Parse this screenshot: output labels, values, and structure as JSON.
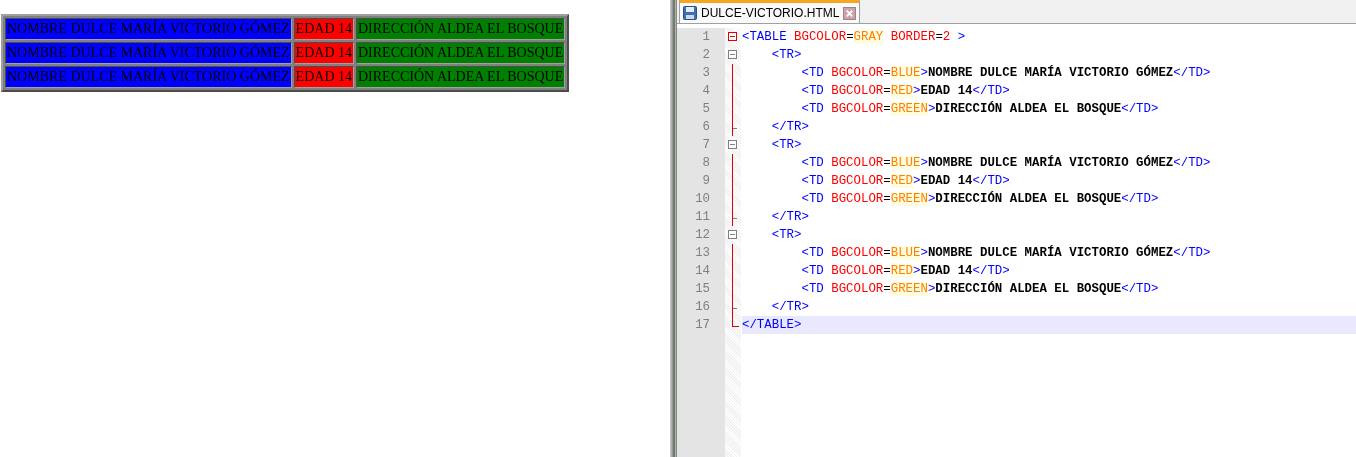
{
  "preview": {
    "table": {
      "rows": [
        {
          "cells": [
            {
              "text": "NOMBRE DULCE MARÍA VICTORIO GÓMEZ",
              "color": "#0000ff"
            },
            {
              "text": "EDAD 14",
              "color": "#ff0000"
            },
            {
              "text": "DIRECCIÓN ALDEA EL BOSQUE",
              "color": "#008000"
            }
          ]
        },
        {
          "cells": [
            {
              "text": "NOMBRE DULCE MARÍA VICTORIO GÓMEZ",
              "color": "#0000ff"
            },
            {
              "text": "EDAD 14",
              "color": "#ff0000"
            },
            {
              "text": "DIRECCIÓN ALDEA EL BOSQUE",
              "color": "#008000"
            }
          ]
        },
        {
          "cells": [
            {
              "text": "NOMBRE DULCE MARÍA VICTORIO GÓMEZ",
              "color": "#0000ff"
            },
            {
              "text": "EDAD 14",
              "color": "#ff0000"
            },
            {
              "text": "DIRECCIÓN ALDEA EL BOSQUE",
              "color": "#008000"
            }
          ]
        }
      ]
    }
  },
  "editor": {
    "tabs": [
      {
        "label": "DULCE-VICTORIO.HTML",
        "selected": true
      }
    ],
    "lines": [
      {
        "number": "1",
        "kind": "outer-start",
        "current": false,
        "tokens": [
          {
            "kind": "tag",
            "text": "<TABLE"
          },
          {
            "kind": "attr",
            "text": " BGCOLOR"
          },
          {
            "kind": "eq",
            "text": "="
          },
          {
            "kind": "value",
            "text": "GRAY"
          },
          {
            "kind": "attr",
            "text": " BORDER"
          },
          {
            "kind": "eq",
            "text": "="
          },
          {
            "kind": "number",
            "text": "2"
          },
          {
            "kind": "tag",
            "text": " >"
          }
        ]
      },
      {
        "number": "2",
        "kind": "inner-start",
        "current": false,
        "tokens": [
          {
            "kind": "tag",
            "text": "    <TR>"
          }
        ]
      },
      {
        "number": "3",
        "kind": "body",
        "current": false,
        "tokens": [
          {
            "kind": "tag",
            "text": "        <TD"
          },
          {
            "kind": "attr",
            "text": " BGCOLOR"
          },
          {
            "kind": "eq",
            "text": "="
          },
          {
            "kind": "value",
            "text": "BLUE"
          },
          {
            "kind": "tag",
            "text": ">"
          },
          {
            "kind": "text",
            "text": "NOMBRE DULCE MARÍA VICTORIO GÓMEZ"
          },
          {
            "kind": "tag",
            "text": "</TD>"
          }
        ]
      },
      {
        "number": "4",
        "kind": "body",
        "current": false,
        "tokens": [
          {
            "kind": "tag",
            "text": "        <TD"
          },
          {
            "kind": "attr",
            "text": " BGCOLOR"
          },
          {
            "kind": "eq",
            "text": "="
          },
          {
            "kind": "value",
            "text": "RED"
          },
          {
            "kind": "tag",
            "text": ">"
          },
          {
            "kind": "text",
            "text": "EDAD 14"
          },
          {
            "kind": "tag",
            "text": "</TD>"
          }
        ]
      },
      {
        "number": "5",
        "kind": "body",
        "current": false,
        "tokens": [
          {
            "kind": "tag",
            "text": "        <TD"
          },
          {
            "kind": "attr",
            "text": " BGCOLOR"
          },
          {
            "kind": "eq",
            "text": "="
          },
          {
            "kind": "value",
            "text": "GREEN"
          },
          {
            "kind": "tag",
            "text": ">"
          },
          {
            "kind": "text",
            "text": "DIRECCIÓN ALDEA EL BOSQUE"
          },
          {
            "kind": "tag",
            "text": "</TD>"
          }
        ]
      },
      {
        "number": "6",
        "kind": "inner-end",
        "current": false,
        "tokens": [
          {
            "kind": "tag",
            "text": "    </TR>"
          }
        ]
      },
      {
        "number": "7",
        "kind": "inner-start",
        "current": false,
        "tokens": [
          {
            "kind": "tag",
            "text": "    <TR>"
          }
        ]
      },
      {
        "number": "8",
        "kind": "body",
        "current": false,
        "tokens": [
          {
            "kind": "tag",
            "text": "        <TD"
          },
          {
            "kind": "attr",
            "text": " BGCOLOR"
          },
          {
            "kind": "eq",
            "text": "="
          },
          {
            "kind": "value",
            "text": "BLUE"
          },
          {
            "kind": "tag",
            "text": ">"
          },
          {
            "kind": "text",
            "text": "NOMBRE DULCE MARÍA VICTORIO GÓMEZ"
          },
          {
            "kind": "tag",
            "text": "</TD>"
          }
        ]
      },
      {
        "number": "9",
        "kind": "body",
        "current": false,
        "tokens": [
          {
            "kind": "tag",
            "text": "        <TD"
          },
          {
            "kind": "attr",
            "text": " BGCOLOR"
          },
          {
            "kind": "eq",
            "text": "="
          },
          {
            "kind": "value",
            "text": "RED"
          },
          {
            "kind": "tag",
            "text": ">"
          },
          {
            "kind": "text",
            "text": "EDAD 14"
          },
          {
            "kind": "tag",
            "text": "</TD>"
          }
        ]
      },
      {
        "number": "10",
        "kind": "body",
        "current": false,
        "tokens": [
          {
            "kind": "tag",
            "text": "        <TD"
          },
          {
            "kind": "attr",
            "text": " BGCOLOR"
          },
          {
            "kind": "eq",
            "text": "="
          },
          {
            "kind": "value",
            "text": "GREEN"
          },
          {
            "kind": "tag",
            "text": ">"
          },
          {
            "kind": "text",
            "text": "DIRECCIÓN ALDEA EL BOSQUE"
          },
          {
            "kind": "tag",
            "text": "</TD>"
          }
        ]
      },
      {
        "number": "11",
        "kind": "inner-end",
        "current": false,
        "tokens": [
          {
            "kind": "tag",
            "text": "    </TR>"
          }
        ]
      },
      {
        "number": "12",
        "kind": "inner-start",
        "current": false,
        "tokens": [
          {
            "kind": "tag",
            "text": "    <TR>"
          }
        ]
      },
      {
        "number": "13",
        "kind": "body",
        "current": false,
        "tokens": [
          {
            "kind": "tag",
            "text": "        <TD"
          },
          {
            "kind": "attr",
            "text": " BGCOLOR"
          },
          {
            "kind": "eq",
            "text": "="
          },
          {
            "kind": "value",
            "text": "BLUE"
          },
          {
            "kind": "tag",
            "text": ">"
          },
          {
            "kind": "text",
            "text": "NOMBRE DULCE MARÍA VICTORIO GÓMEZ"
          },
          {
            "kind": "tag",
            "text": "</TD>"
          }
        ]
      },
      {
        "number": "14",
        "kind": "body",
        "current": false,
        "tokens": [
          {
            "kind": "tag",
            "text": "        <TD"
          },
          {
            "kind": "attr",
            "text": " BGCOLOR"
          },
          {
            "kind": "eq",
            "text": "="
          },
          {
            "kind": "value",
            "text": "RED"
          },
          {
            "kind": "tag",
            "text": ">"
          },
          {
            "kind": "text",
            "text": "EDAD 14"
          },
          {
            "kind": "tag",
            "text": "</TD>"
          }
        ]
      },
      {
        "number": "15",
        "kind": "body",
        "current": false,
        "tokens": [
          {
            "kind": "tag",
            "text": "        <TD"
          },
          {
            "kind": "attr",
            "text": " BGCOLOR"
          },
          {
            "kind": "eq",
            "text": "="
          },
          {
            "kind": "value",
            "text": "GREEN"
          },
          {
            "kind": "tag",
            "text": ">"
          },
          {
            "kind": "text",
            "text": "DIRECCIÓN ALDEA EL BOSQUE"
          },
          {
            "kind": "tag",
            "text": "</TD>"
          }
        ]
      },
      {
        "number": "16",
        "kind": "inner-end",
        "current": false,
        "tokens": [
          {
            "kind": "tag",
            "text": "    </TR>"
          }
        ]
      },
      {
        "number": "17",
        "kind": "outer-end",
        "current": true,
        "tokens": [
          {
            "kind": "tag",
            "text": "</TABLE>"
          }
        ]
      }
    ]
  }
}
